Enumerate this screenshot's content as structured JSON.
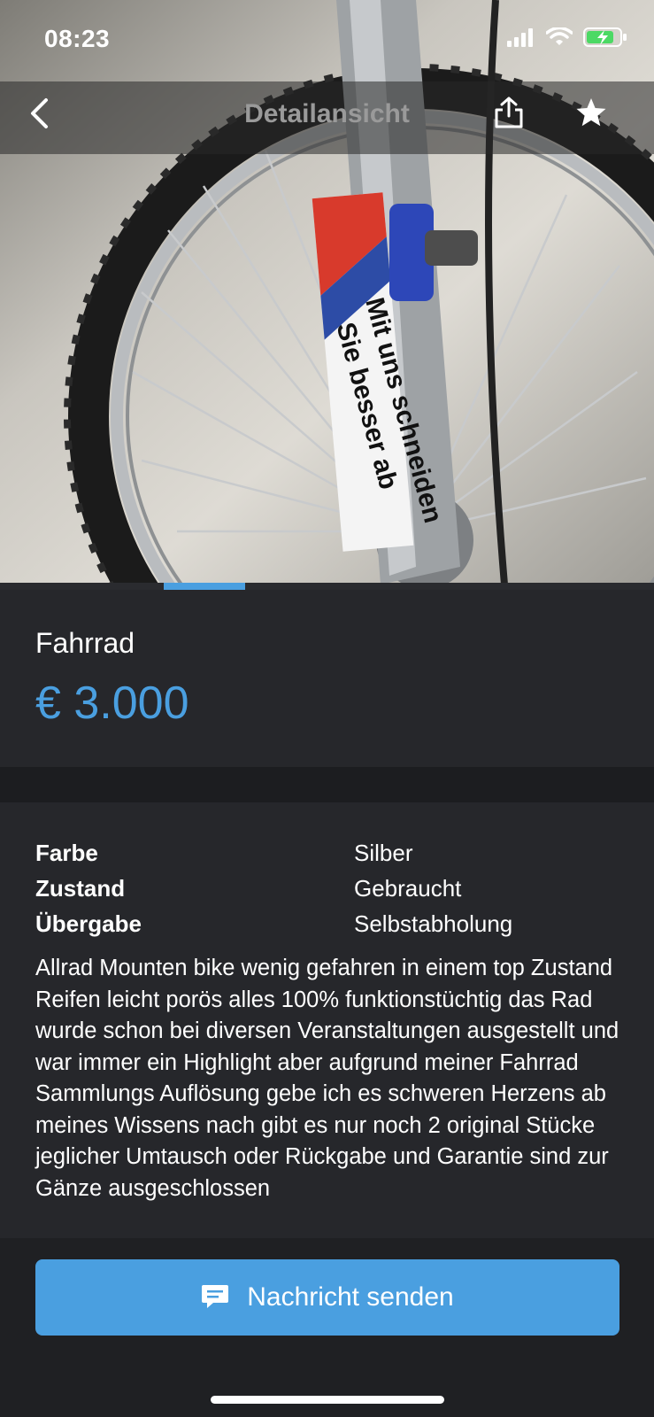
{
  "status_bar": {
    "time": "08:23"
  },
  "nav": {
    "title": "Detailansicht",
    "back_icon": "chevron-left-icon",
    "share_icon": "share-icon",
    "favorite_icon": "star-icon"
  },
  "photo": {
    "fork_text_line1": "Mit uns schneiden",
    "fork_text_line2": "Sie besser ab"
  },
  "pager": {
    "total": 8,
    "active_index": 2
  },
  "listing": {
    "title": "Fahrrad",
    "price": "€ 3.000",
    "attributes": [
      {
        "key": "Farbe",
        "value": "Silber"
      },
      {
        "key": "Zustand",
        "value": "Gebraucht"
      },
      {
        "key": "Übergabe",
        "value": "Selbstabholung"
      }
    ],
    "description": "Allrad Mounten bike wenig gefahren in einem top Zustand Reifen leicht porös alles 100% funktionstüchtig das Rad wurde schon bei diversen Veranstaltungen ausgestellt und war immer ein Highlight aber aufgrund meiner Fahrrad Sammlungs Auflösung gebe ich es schweren Herzens ab meines Wissens nach gibt es nur noch 2 original Stücke jeglicher Umtausch oder Rückgabe und Garantie sind zur Gänze ausgeschlossen"
  },
  "actions": {
    "send_message_label": "Nachricht senden",
    "send_icon": "chat-bubble-icon"
  },
  "colors": {
    "accent": "#4a9fe0",
    "background": "#1f2023",
    "card": "#26272b",
    "nav_title": "#9a9a9a"
  }
}
